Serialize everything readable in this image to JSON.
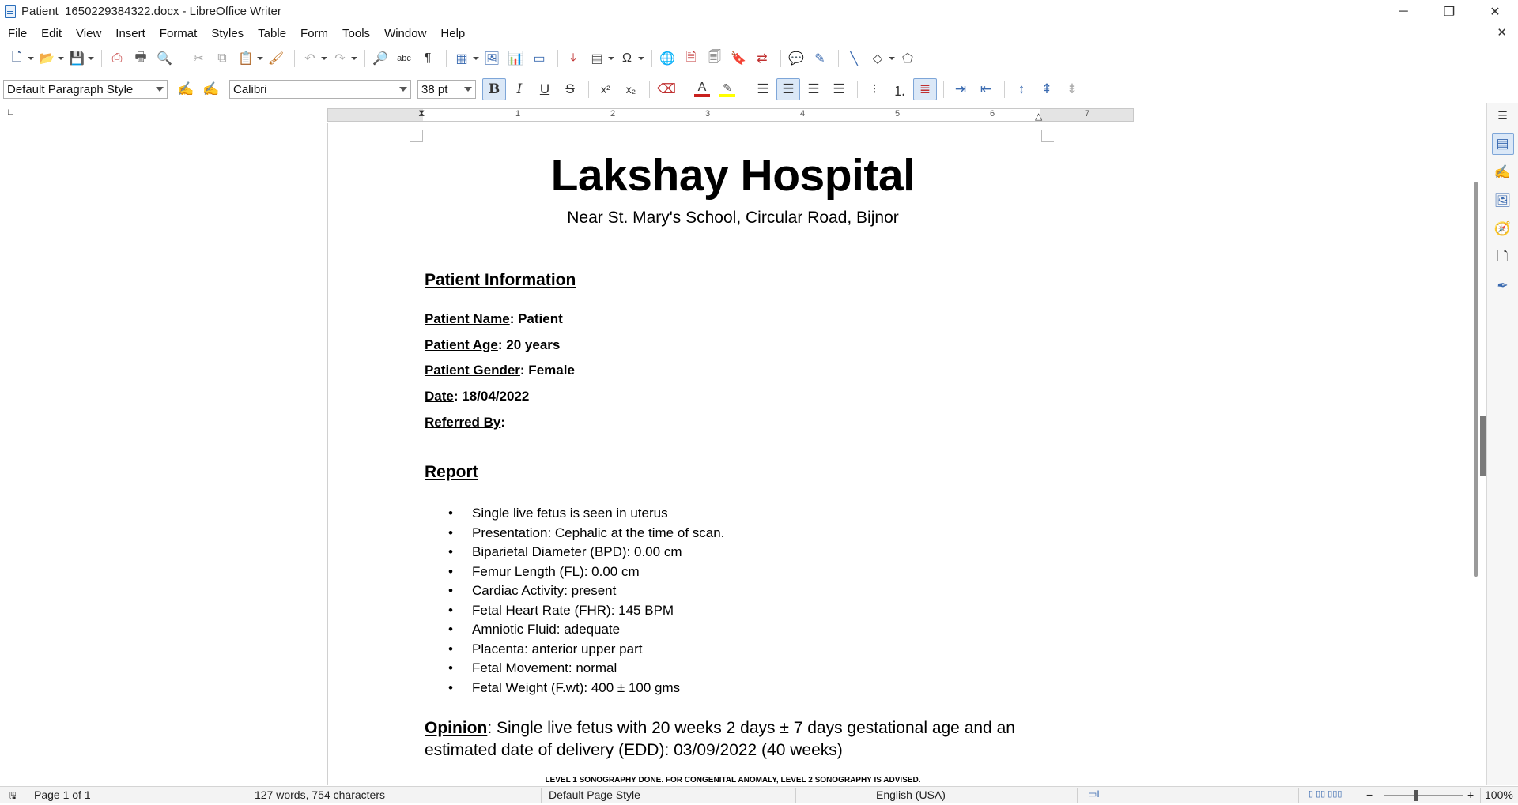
{
  "window": {
    "title": "Patient_1650229384322.docx - LibreOffice Writer",
    "controls": {
      "minimize": "─",
      "restore": "❐",
      "close": "✕"
    },
    "close_doc": "✕"
  },
  "menu": [
    "File",
    "Edit",
    "View",
    "Insert",
    "Format",
    "Styles",
    "Table",
    "Form",
    "Tools",
    "Window",
    "Help"
  ],
  "format_bar": {
    "paragraph_style": "Default Paragraph Style",
    "font_name": "Calibri",
    "font_size": "38 pt",
    "bold": "B",
    "italic": "I",
    "underline": "U",
    "strike": "S",
    "superscript": "x²",
    "subscript": "x₂"
  },
  "ruler": {
    "numbers": [
      "1",
      "2",
      "3",
      "4",
      "5",
      "6",
      "7"
    ]
  },
  "document": {
    "hospital_name": "Lakshay Hospital",
    "address": "Near St. Mary's School, Circular Road, Bijnor",
    "patient_info_heading": "Patient Information",
    "fields": [
      {
        "label": "Patient Name",
        "value": ": Patient"
      },
      {
        "label": "Patient Age",
        "value": ": 20 years"
      },
      {
        "label": "Patient Gender",
        "value": ": Female"
      },
      {
        "label": "Date",
        "value": ": 18/04/2022"
      },
      {
        "label": "Referred By",
        "value": ":"
      }
    ],
    "report_heading": "Report",
    "report_items": [
      "Single live fetus is seen in uterus",
      "Presentation: Cephalic at the time of scan.",
      "Biparietal Diameter (BPD): 0.00 cm",
      "Femur Length (FL): 0.00 cm",
      "Cardiac Activity: present",
      "Fetal Heart Rate (FHR): 145 BPM",
      "Amniotic Fluid: adequate",
      "Placenta: anterior upper part",
      "Fetal Movement: normal",
      "Fetal Weight (F.wt): 400 ± 100 gms"
    ],
    "opinion_label": "Opinion",
    "opinion_text": ": Single live fetus with 20 weeks 2 days ± 7 days gestational age and an estimated date of delivery (EDD): 03/09/2022 (40 weeks)",
    "footnote": "LEVEL 1 SONOGRAPHY DONE. FOR CONGENITAL ANOMALY, LEVEL 2 SONOGRAPHY IS ADVISED."
  },
  "status": {
    "page": "Page 1 of 1",
    "words": "127 words, 754 characters",
    "page_style": "Default Page Style",
    "language": "English (USA)",
    "zoom": "100%",
    "zoom_minus": "−",
    "zoom_plus": "+"
  },
  "colors": {
    "accent": "#3a6ab0",
    "font_color_bar": "#c9211e",
    "highlight_bar": "#ffff00",
    "spellcheck": "#d02020"
  }
}
